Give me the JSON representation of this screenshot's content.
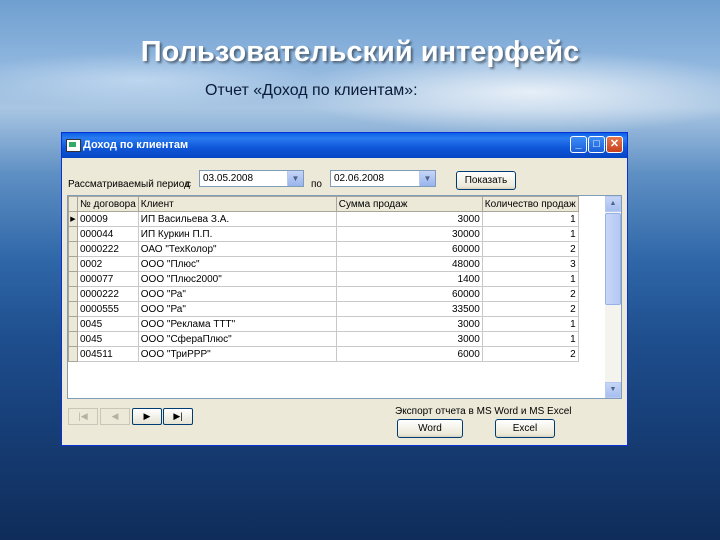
{
  "slide": {
    "title": "Пользовательский интерфейс",
    "subtitle": "Отчет «Доход по клиентам»:"
  },
  "window": {
    "title": "Доход по клиентам",
    "controls": {
      "minimize": "_",
      "maximize": "□",
      "close": "✕"
    }
  },
  "filter": {
    "period_label": "Рассматриваемый период",
    "from_label": "с",
    "from_value": "03.05.2008",
    "to_label": "по",
    "to_value": "02.06.2008",
    "show_button": "Показать"
  },
  "table": {
    "columns": [
      "№ договора",
      "Клиент",
      "Сумма продаж",
      "Количество продаж"
    ],
    "rows": [
      [
        "00009",
        "ИП Васильева З.А.",
        "3000",
        "1"
      ],
      [
        "000044",
        "ИП Куркин П.П.",
        "30000",
        "1"
      ],
      [
        "0000222",
        "ОАО \"ТехКолор\"",
        "60000",
        "2"
      ],
      [
        "0002",
        "ООО \"Плюс\"",
        "48000",
        "3"
      ],
      [
        "000077",
        "ООО \"Плюс2000\"",
        "1400",
        "1"
      ],
      [
        "0000222",
        "ООО \"Ра\"",
        "60000",
        "2"
      ],
      [
        "0000555",
        "ООО \"Ра\"",
        "33500",
        "2"
      ],
      [
        "0045",
        "ООО \"Реклама ТТТ\"",
        "3000",
        "1"
      ],
      [
        "0045",
        "ООО \"СфераПлюс\"",
        "3000",
        "1"
      ],
      [
        "004511",
        "ООО \"ТриРРР\"",
        "6000",
        "2"
      ]
    ]
  },
  "navigation": {
    "first": "|◀",
    "prev": "◀",
    "next": "▶",
    "last": "▶|"
  },
  "export": {
    "label": "Экспорт отчета в MS Word и MS Excel",
    "word_button": "Word",
    "excel_button": "Excel"
  }
}
